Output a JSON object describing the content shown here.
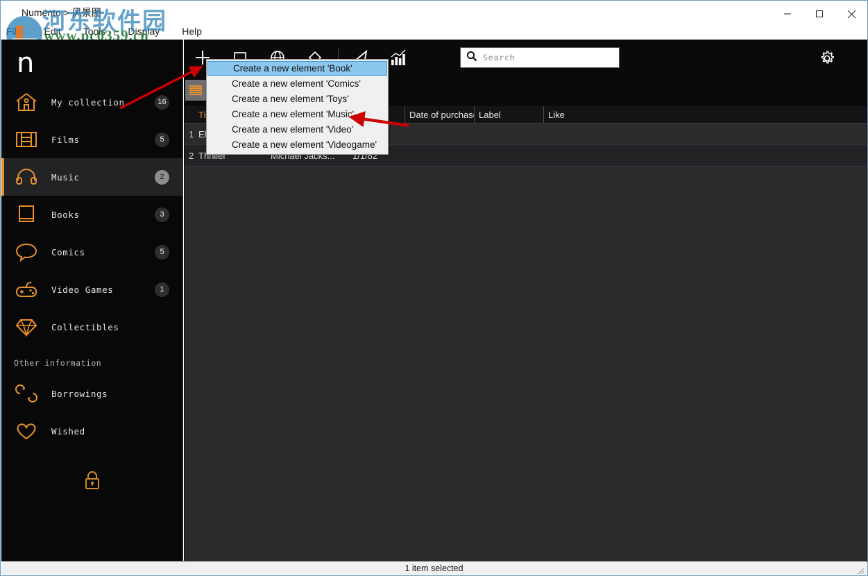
{
  "window": {
    "title": "Numento > 风景图",
    "minimize_label": "—",
    "maximize_label": "▢",
    "close_label": "✕"
  },
  "watermark": {
    "cn_text": "河东软件园",
    "url_text": "www.pc0359.cn"
  },
  "menubar": {
    "items": [
      {
        "label": "File"
      },
      {
        "label": "Edit"
      },
      {
        "label": "Tools"
      },
      {
        "label": "Display"
      },
      {
        "label": "Help"
      }
    ]
  },
  "sidebar": {
    "logo": "n",
    "items": [
      {
        "label": "My collection",
        "count": "16",
        "icon": "home-icon",
        "active": false
      },
      {
        "label": "Films",
        "count": "5",
        "icon": "film-icon",
        "active": false
      },
      {
        "label": "Music",
        "count": "2",
        "icon": "headphones-icon",
        "active": true
      },
      {
        "label": "Books",
        "count": "3",
        "icon": "book-icon",
        "active": false
      },
      {
        "label": "Comics",
        "count": "5",
        "icon": "speech-bubble-icon",
        "active": false
      },
      {
        "label": "Video Games",
        "count": "1",
        "icon": "gamepad-icon",
        "active": false
      },
      {
        "label": "Collectibles",
        "count": "",
        "icon": "diamond-icon",
        "active": false
      }
    ],
    "section_label": "Other information",
    "other_items": [
      {
        "label": "Borrowings",
        "count": "",
        "icon": "borrow-icon"
      },
      {
        "label": "Wished",
        "count": "",
        "icon": "heart-icon"
      }
    ],
    "lock_icon": "padlock-icon"
  },
  "toolbar": {
    "add_label": "+",
    "icons": [
      "add-icon",
      "edit-icon",
      "globe-icon",
      "tag-icon",
      "export-icon",
      "statistics-icon"
    ],
    "settings_icon": "gear-icon",
    "view_toggle_icon": "list-view-icon"
  },
  "search": {
    "placeholder": "Search",
    "value": "",
    "icon": "search-icon"
  },
  "context_menu": {
    "items": [
      {
        "label": "Create a new element 'Book'",
        "highlighted": true
      },
      {
        "label": "Create a new element 'Comics'",
        "highlighted": false
      },
      {
        "label": "Create a new element 'Toys'",
        "highlighted": false
      },
      {
        "label": "Create a new element 'Music'",
        "highlighted": false
      },
      {
        "label": "Create a new element 'Video'",
        "highlighted": false
      },
      {
        "label": "Create a new element 'Videogame'",
        "highlighted": false
      }
    ]
  },
  "table": {
    "columns": [
      {
        "key": "num",
        "label": "",
        "sorted": false
      },
      {
        "key": "title",
        "label": "Ti",
        "sorted": true
      },
      {
        "key": "art",
        "label": "",
        "sorted": false
      },
      {
        "key": "year",
        "label": "",
        "sorted": false
      },
      {
        "key": "date",
        "label": "Date of purchase",
        "sorted": false
      },
      {
        "key": "label",
        "label": "Label",
        "sorted": false
      },
      {
        "key": "like",
        "label": "Like",
        "sorted": false
      }
    ],
    "rows": [
      {
        "num": "1",
        "title": "El",
        "art": "",
        "year": "",
        "date": "",
        "label": "",
        "like": ""
      },
      {
        "num": "2",
        "title": "Thriller",
        "art": "Michael Jacks...",
        "year": "1/1/82",
        "date": "",
        "label": "",
        "like": ""
      }
    ]
  },
  "statusbar": {
    "text": "1 item selected"
  },
  "colors": {
    "accent": "#e8902a",
    "sidebar_bg": "#080808",
    "content_bg": "#2b2b2e",
    "highlight": "#8cc8ee",
    "arrow": "#cc0000"
  }
}
